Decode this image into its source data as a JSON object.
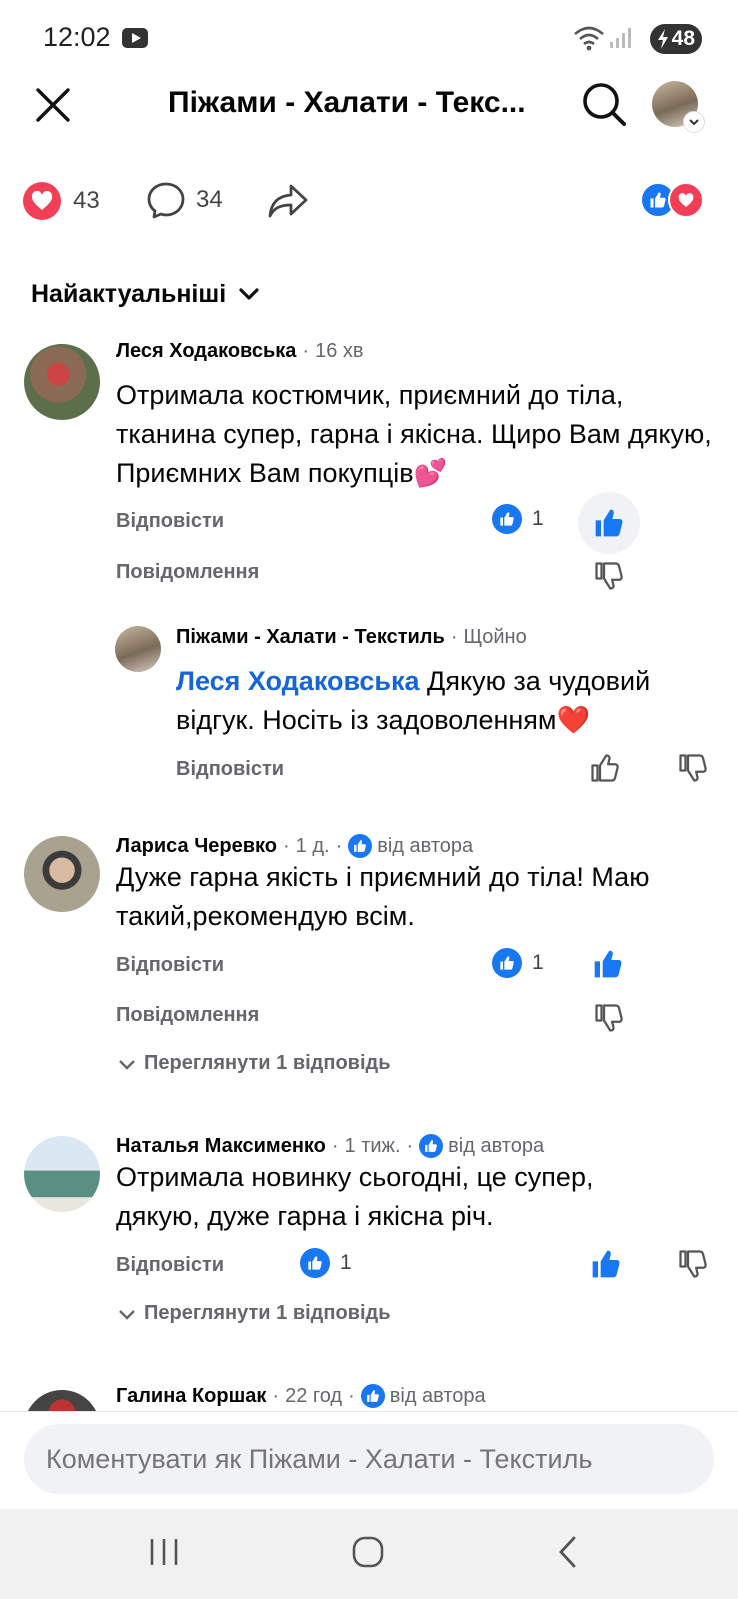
{
  "status_bar": {
    "time": "12:02",
    "battery": "48"
  },
  "header": {
    "title": "Піжами - Халати - Текс..."
  },
  "reactions": {
    "love_count": "43",
    "comment_count": "34"
  },
  "sort": {
    "label": "Найактуальніші"
  },
  "comments": [
    {
      "author": "Леся Ходаковська",
      "time": "16 хв",
      "text": "Отримала костюмчик, приємний до тіла, тканина супер, гарна і якісна. Щиро Вам дякую, Приємних Вам покупців💕",
      "reply_label": "Відповісти",
      "message_label": "Повідомлення",
      "like_count": "1"
    },
    {
      "author": "Піжами - Халати - Текстиль",
      "time": "Щойно",
      "mention": "Леся Ходаковська",
      "text": " Дякую за чудовий відгук. Носіть із задоволенням❤️",
      "reply_label": "Відповісти"
    },
    {
      "author": "Лариса Черевко",
      "time": "1 д.",
      "badge": "від автора",
      "text": "Дуже гарна якість і приємний до тіла! Маю такий,рекомендую всім.",
      "reply_label": "Відповісти",
      "message_label": "Повідомлення",
      "like_count": "1",
      "view_replies": "Переглянути 1 відповідь"
    },
    {
      "author": "Наталья Максименко",
      "time": "1 тиж.",
      "badge": "від автора",
      "text": "Отримала новинку сьогодні, це супер, дякую, дуже гарна і якісна річ.",
      "reply_label": "Відповісти",
      "like_count": "1",
      "view_replies": "Переглянути 1 відповідь"
    },
    {
      "author": "Галина Коршак",
      "time": "22 год",
      "badge": "від автора"
    }
  ],
  "composer": {
    "placeholder": "Коментувати як Піжами - Халати - Текстиль"
  },
  "colors": {
    "accent_blue": "#1877f2",
    "love_red": "#f33e58",
    "meta_gray": "#65676b"
  }
}
